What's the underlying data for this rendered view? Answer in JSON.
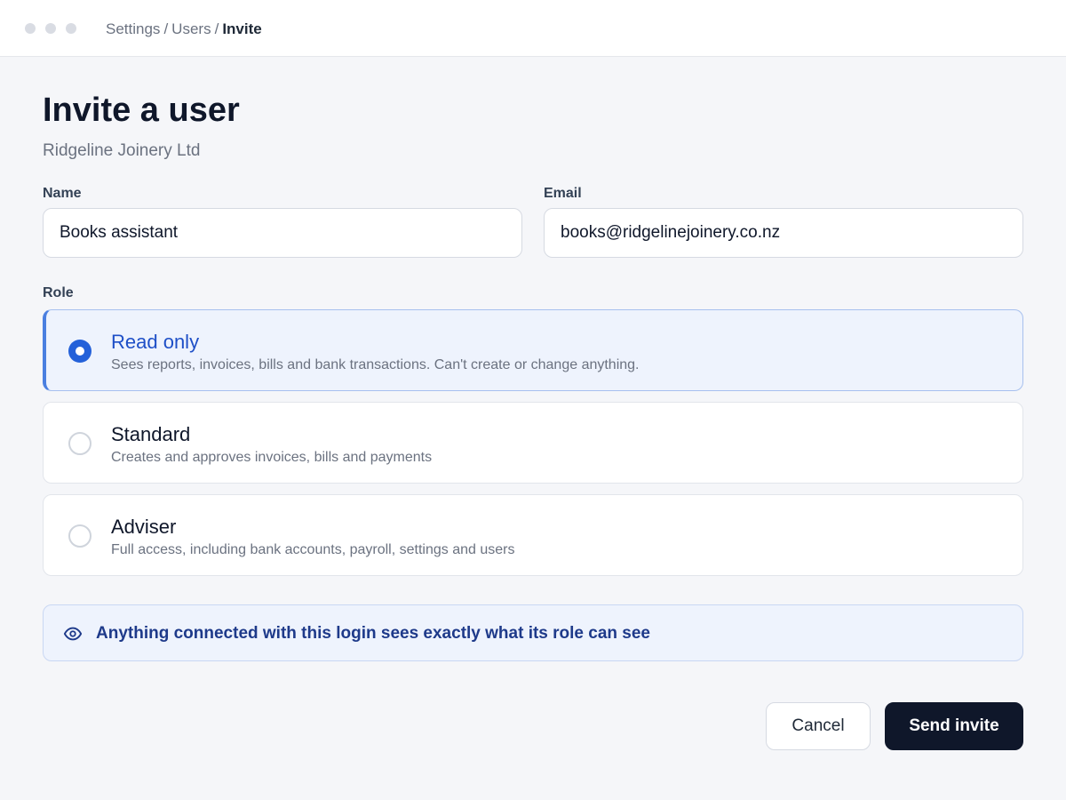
{
  "window": {
    "controls": [
      "window-dot",
      "window-dot",
      "window-dot"
    ]
  },
  "breadcrumb": {
    "items": [
      "Settings",
      "Users"
    ],
    "current": "Invite",
    "separator": "/"
  },
  "page": {
    "title": "Invite a user",
    "subtitle": "Ridgeline Joinery Ltd"
  },
  "form": {
    "name": {
      "label": "Name",
      "value": "Books assistant"
    },
    "email": {
      "label": "Email",
      "value": "books@ridgelinejoinery.co.nz"
    },
    "role": {
      "label": "Role",
      "selected": "Read only",
      "options": [
        {
          "title": "Read only",
          "description": "Sees reports, invoices, bills and bank transactions. Can't create or change anything.",
          "selected": true
        },
        {
          "title": "Standard",
          "description": "Creates and approves invoices, bills and payments",
          "selected": false
        },
        {
          "title": "Adviser",
          "description": "Full access, including bank accounts, payroll, settings and users",
          "selected": false
        }
      ]
    }
  },
  "notice": {
    "icon": "eye-icon",
    "text": "Anything connected with this login sees exactly what its role can see"
  },
  "actions": {
    "cancel_label": "Cancel",
    "send_label": "Send invite"
  },
  "colors": {
    "accent": "#2461d9",
    "primary_button": "#0f172a",
    "notice_text": "#1e3a8a",
    "background": "#f5f6f9"
  }
}
